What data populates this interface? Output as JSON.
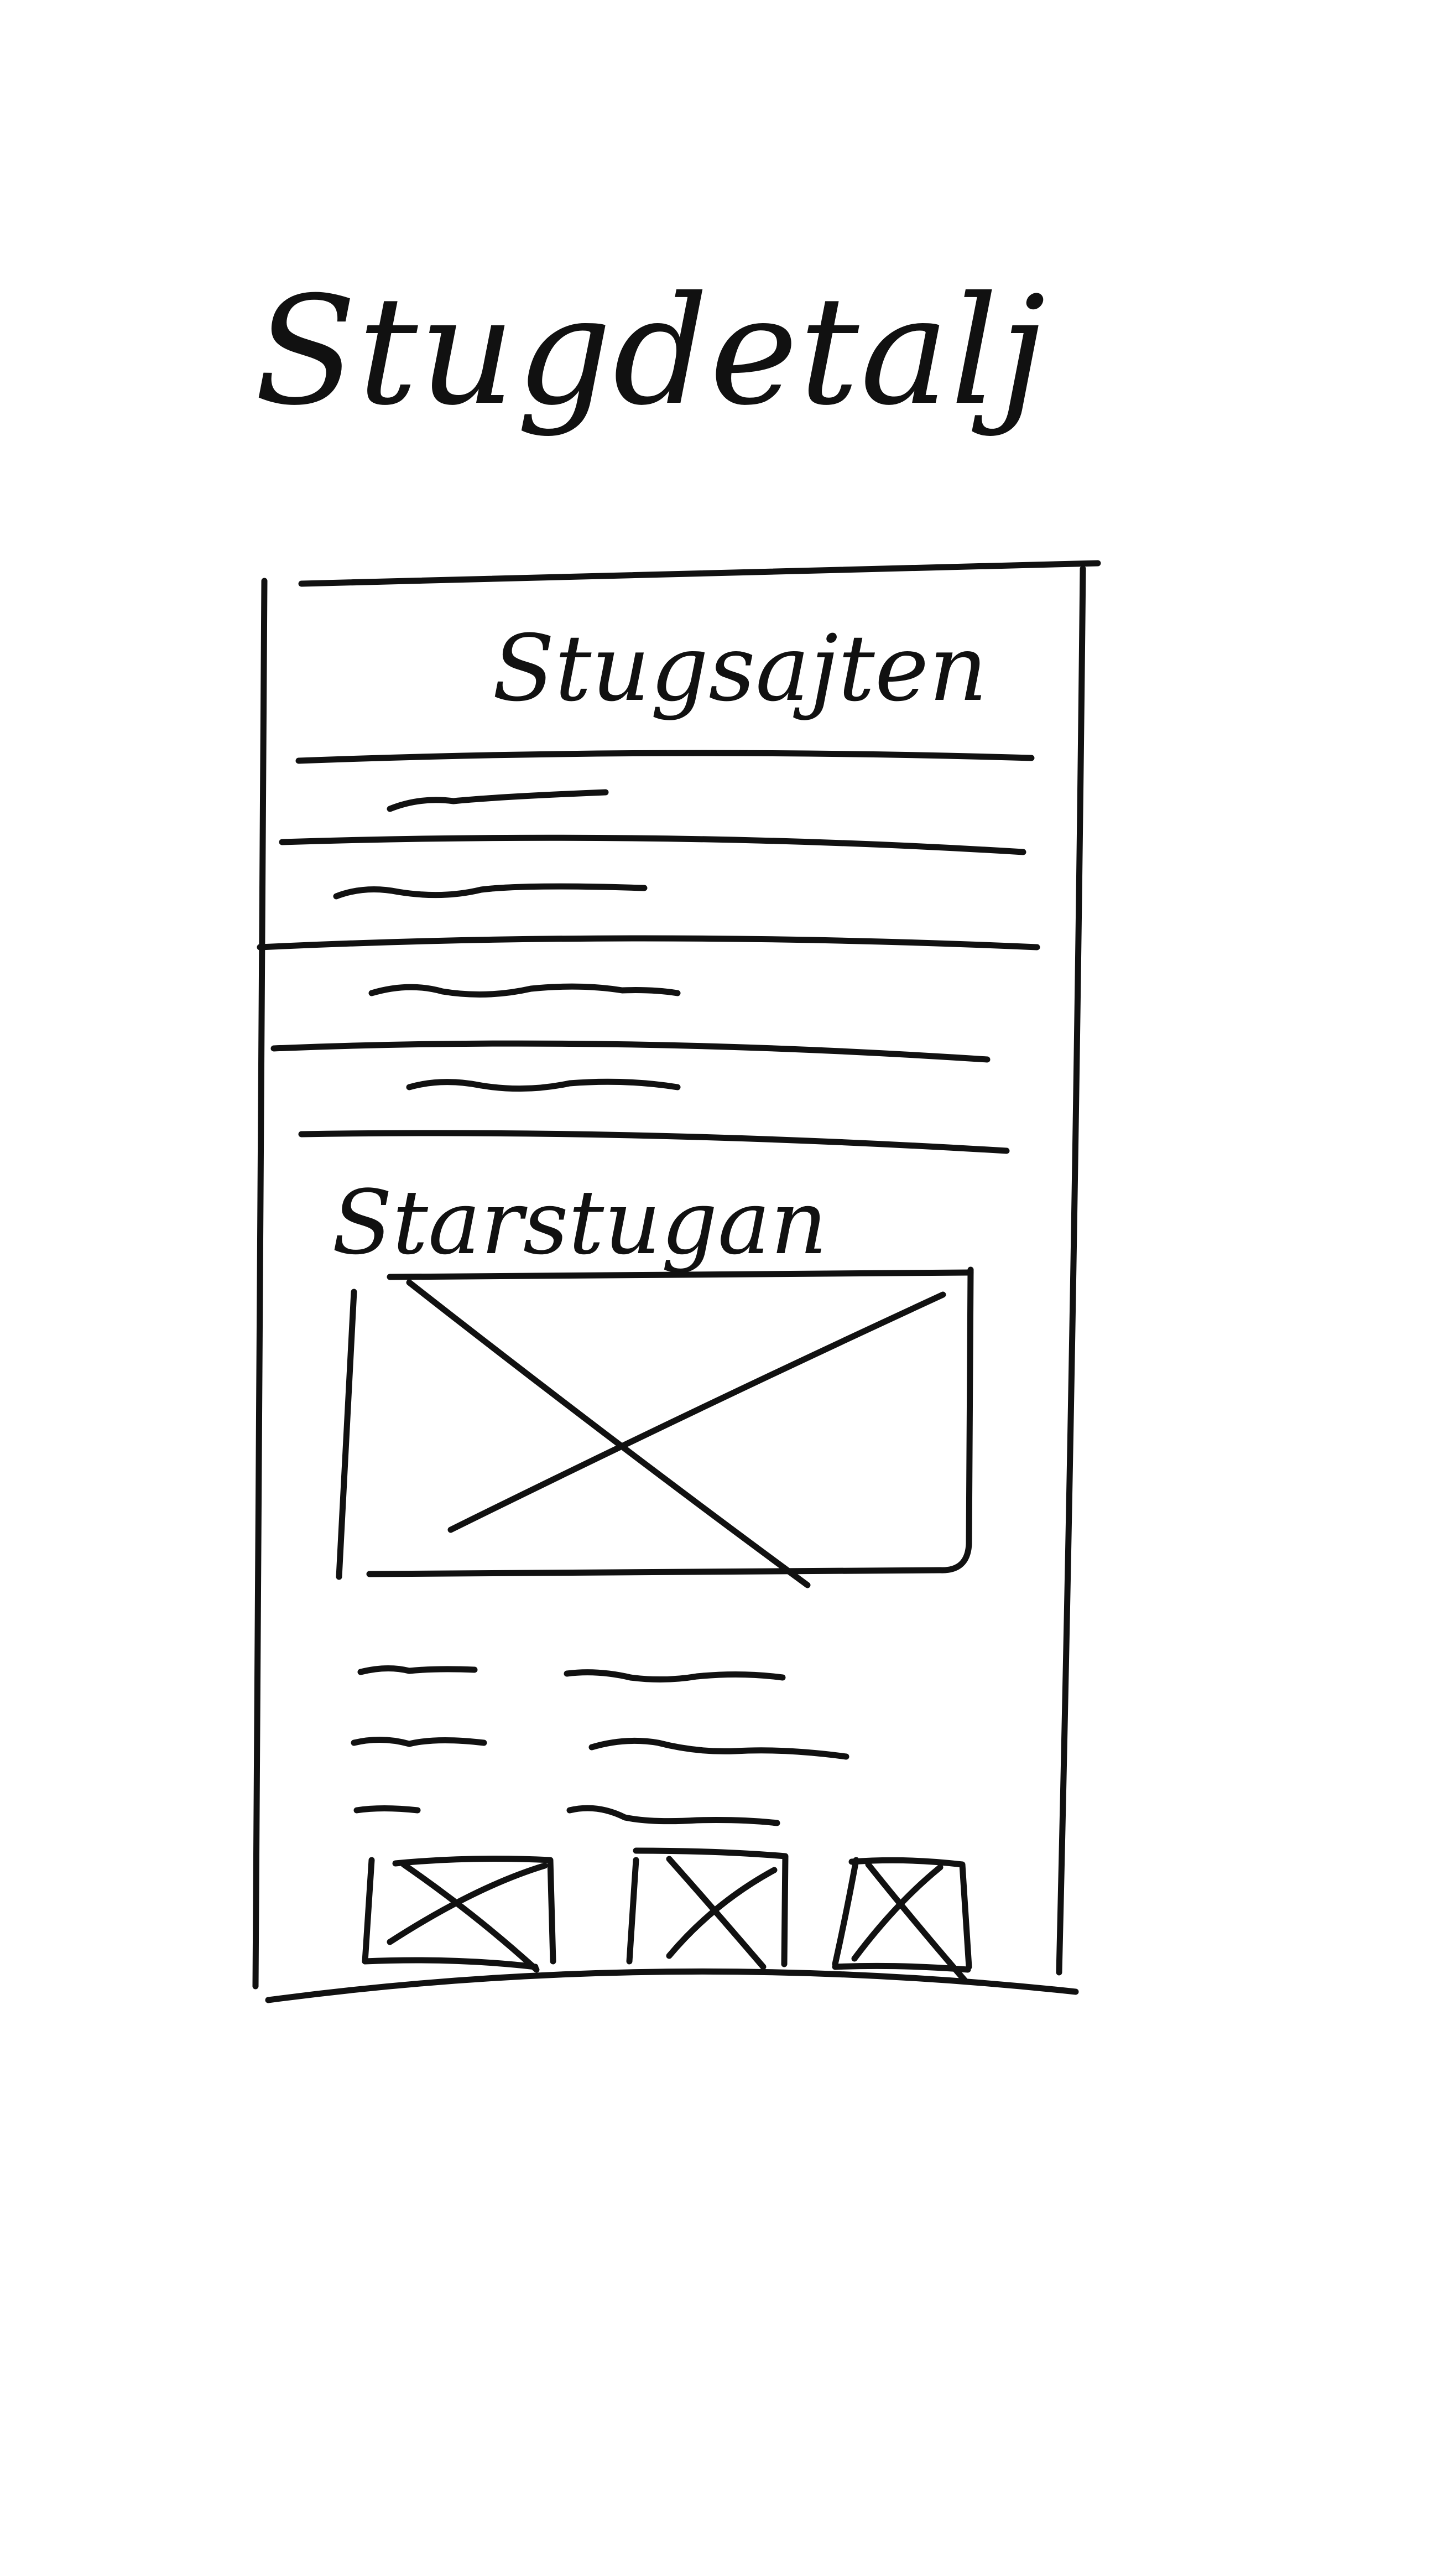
{
  "page": {
    "title": "Stugdetalj"
  },
  "header": {
    "site_name": "Stugsajten"
  },
  "nav": {
    "items": [
      {
        "label": ""
      },
      {
        "label": ""
      },
      {
        "label": ""
      },
      {
        "label": ""
      }
    ]
  },
  "cabin": {
    "name": "Starstugan",
    "image_icon": "image-placeholder-icon",
    "details": [
      {
        "label": "",
        "value": ""
      },
      {
        "label": "",
        "value": ""
      },
      {
        "label": "",
        "value": ""
      }
    ],
    "thumbnails": [
      {
        "icon": "image-placeholder-icon"
      },
      {
        "icon": "image-placeholder-icon"
      },
      {
        "icon": "image-placeholder-icon"
      }
    ]
  },
  "colors": {
    "ink": "#111111",
    "paper": "#ffffff"
  }
}
